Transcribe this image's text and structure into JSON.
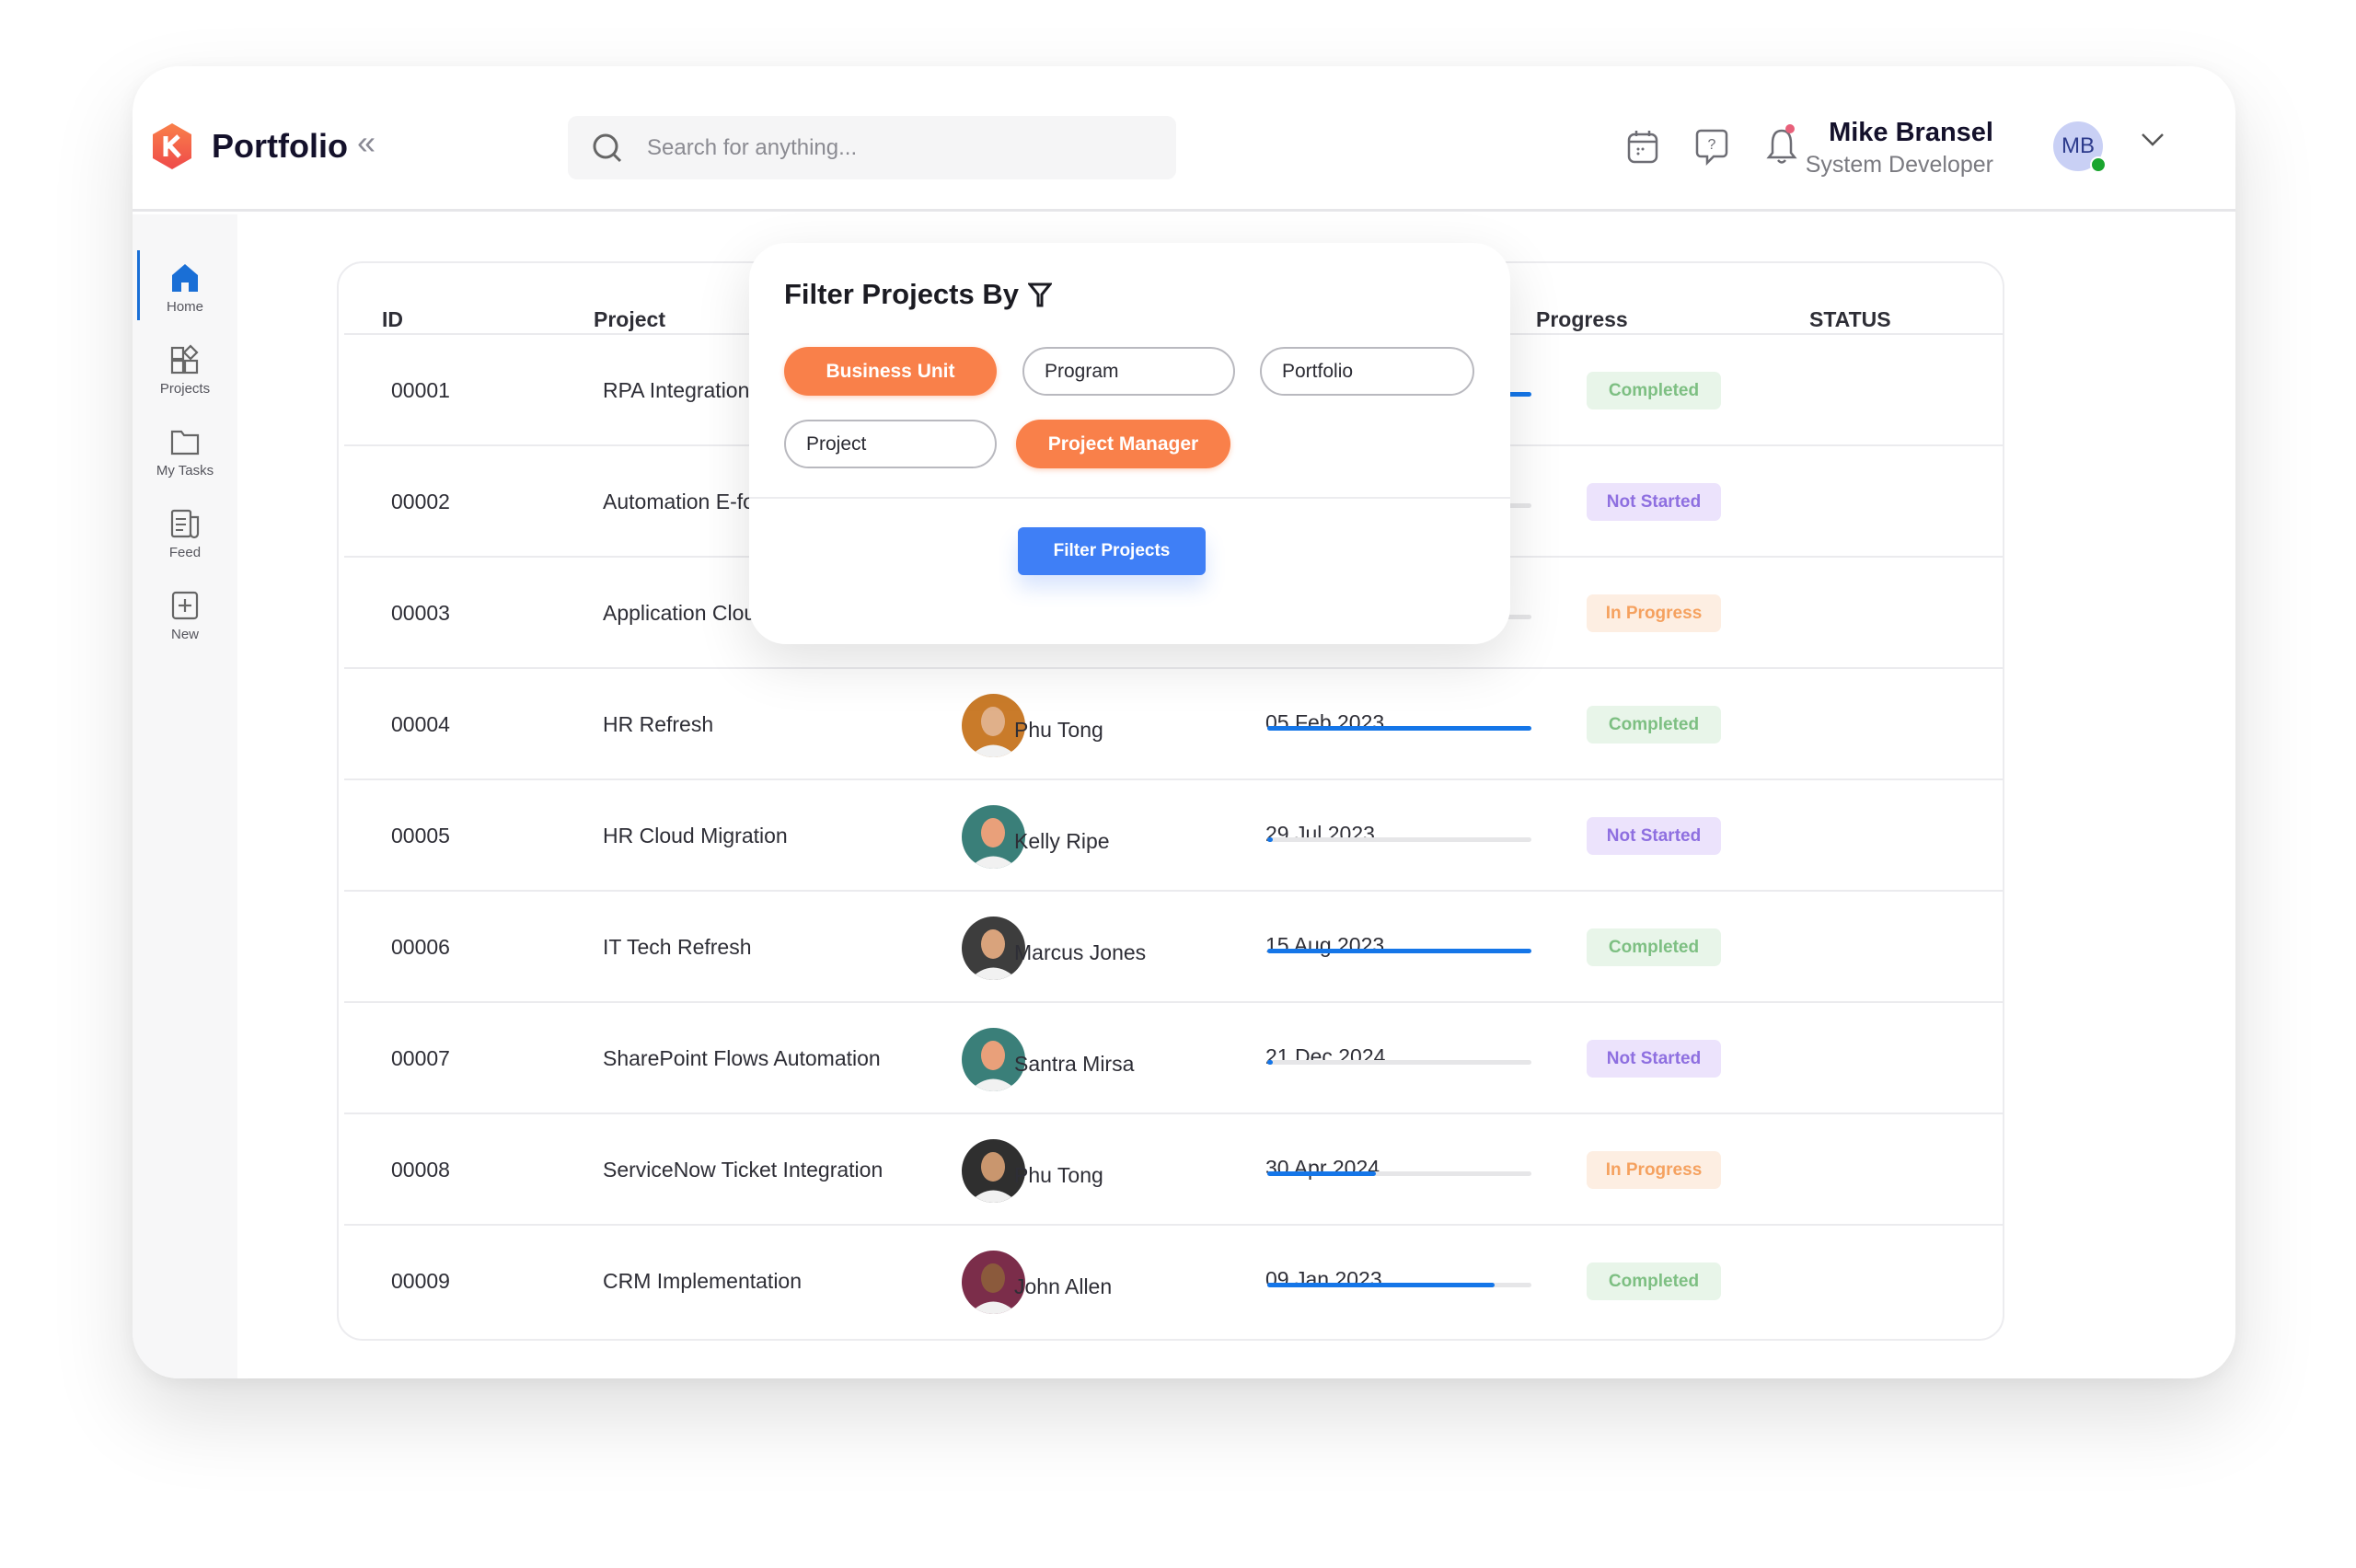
{
  "header": {
    "brand": "Portfolio",
    "search_placeholder": "Search for anything...",
    "user": {
      "name": "Mike Bransel",
      "role": "System Developer",
      "initials": "MB",
      "online": true
    }
  },
  "sidebar": {
    "items": [
      {
        "label": "Home",
        "icon": "home-icon",
        "active": true
      },
      {
        "label": "Projects",
        "icon": "projects-icon"
      },
      {
        "label": "My Tasks",
        "icon": "folder-icon"
      },
      {
        "label": "Feed",
        "icon": "feed-icon"
      },
      {
        "label": "New",
        "icon": "plus-square-icon"
      }
    ]
  },
  "table": {
    "headers": {
      "id": "ID",
      "project": "Project",
      "progress": "Progress",
      "status": "STATUS"
    },
    "rows": [
      {
        "id": "00001",
        "project": "RPA Integration",
        "manager": "",
        "date": "",
        "progress": 100,
        "status": "Completed"
      },
      {
        "id": "00002",
        "project": "Automation E-fo",
        "manager": "",
        "date": "",
        "progress": 0,
        "status": "Not Started"
      },
      {
        "id": "00003",
        "project": "Application Clou",
        "manager": "",
        "date": "",
        "progress": 59,
        "status": "In Progress"
      },
      {
        "id": "00004",
        "project": "HR Refresh",
        "manager": "Phu Tong",
        "date": "05 Feb 2023",
        "progress": 100,
        "status": "Completed"
      },
      {
        "id": "00005",
        "project": "HR Cloud Migration",
        "manager": "Kelly Ripe",
        "date": "29 Jul 2023",
        "progress": 2,
        "status": "Not Started"
      },
      {
        "id": "00006",
        "project": "IT Tech Refresh",
        "manager": "Marcus Jones",
        "date": "15 Aug 2023",
        "progress": 100,
        "status": "Completed"
      },
      {
        "id": "00007",
        "project": "SharePoint Flows Automation",
        "manager": "Santra Mirsa",
        "date": "21 Dec 2024",
        "progress": 2,
        "status": "Not Started"
      },
      {
        "id": "00008",
        "project": "ServiceNow Ticket Integration",
        "manager": "Phu Tong",
        "date": "30 Apr 2024",
        "progress": 41,
        "status": "In Progress"
      },
      {
        "id": "00009",
        "project": "CRM Implementation",
        "manager": "John Allen",
        "date": "09 Jan 2023",
        "progress": 86,
        "status": "Completed"
      }
    ]
  },
  "status_colors": {
    "Completed": {
      "bg": "#e8f5e9",
      "fg": "#7dbf82"
    },
    "Not Started": {
      "bg": "#ece3fc",
      "fg": "#8e6fe0"
    },
    "In Progress": {
      "bg": "#fdeee2",
      "fg": "#f5a15f"
    }
  },
  "filter": {
    "title": "Filter Projects By",
    "options": [
      {
        "label": "Business Unit",
        "selected": true
      },
      {
        "label": "Program",
        "selected": false
      },
      {
        "label": "Portfolio",
        "selected": false
      },
      {
        "label": "Project",
        "selected": false
      },
      {
        "label": "Project Manager",
        "selected": true
      }
    ],
    "submit": "Filter Projects"
  },
  "colors": {
    "accent": "#f9804a",
    "primary": "#3f7ff6",
    "progress": "#1576e8"
  }
}
